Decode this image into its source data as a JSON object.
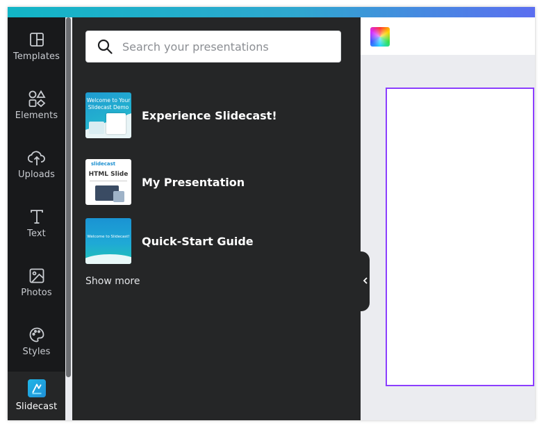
{
  "rail": {
    "items": [
      {
        "label": "Templates",
        "icon": "templates-icon"
      },
      {
        "label": "Elements",
        "icon": "elements-icon"
      },
      {
        "label": "Uploads",
        "icon": "upload-cloud-icon"
      },
      {
        "label": "Text",
        "icon": "text-icon"
      },
      {
        "label": "Photos",
        "icon": "photo-icon"
      },
      {
        "label": "Styles",
        "icon": "palette-icon"
      },
      {
        "label": "Slidecast",
        "icon": "slidecast-app-icon",
        "active": true
      }
    ]
  },
  "panel": {
    "search": {
      "placeholder": "Search your presentations",
      "value": ""
    },
    "presentations": [
      {
        "title": "Experience Slidecast!",
        "thumb_text": "Welcome to Your\nSlidecast Demo"
      },
      {
        "title": "My Presentation",
        "thumb_logo": "slidecast",
        "thumb_text": "HTML Slide"
      },
      {
        "title": "Quick-Start Guide",
        "thumb_text": "Welcome to Slidecast!"
      }
    ],
    "show_more": "Show more"
  },
  "colors": {
    "accent": "#8b3dff",
    "rail_bg": "#18191b",
    "panel_bg": "#252627",
    "canvas_bg": "#ebecf0"
  }
}
